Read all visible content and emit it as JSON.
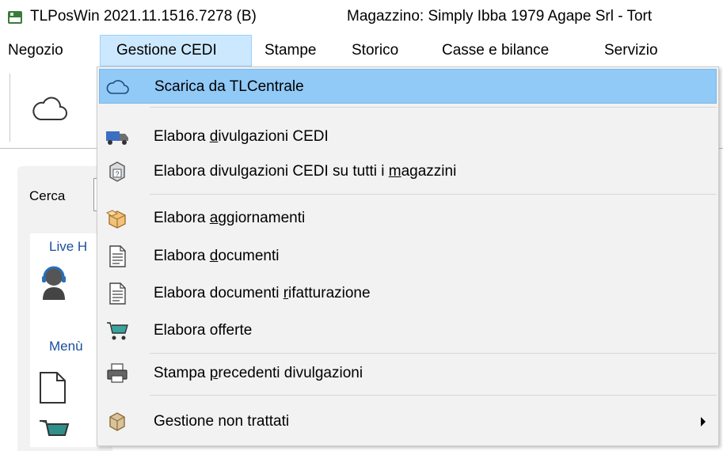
{
  "window": {
    "title": "TLPosWin 2021.11.1516.7278 (B)",
    "store": "Magazzino: Simply Ibba 1979 Agape Srl - Tort"
  },
  "menubar": {
    "items": [
      {
        "label": "Negozio"
      },
      {
        "label": "Gestione CEDI"
      },
      {
        "label": "Stampe"
      },
      {
        "label": "Storico"
      },
      {
        "label": "Casse e bilance"
      },
      {
        "label": "Servizio"
      }
    ]
  },
  "background": {
    "cerca_label": "Cerca",
    "live_label": "Live H",
    "menu_label": "Menù"
  },
  "dropdown": {
    "items": [
      {
        "pre": "Scarica da TLCentrale",
        "u": "",
        "post": "",
        "icon": "cloud-icon"
      },
      {
        "pre": "Elabora ",
        "u": "d",
        "post": "ivulgazioni CEDI",
        "icon": "truck-icon"
      },
      {
        "pre": "Elabora divulgazioni CEDI su tutti i ",
        "u": "m",
        "post": "agazzini",
        "icon": "box-question-icon"
      },
      {
        "pre": "Elabora ",
        "u": "a",
        "post": "ggiornamenti",
        "icon": "package-icon"
      },
      {
        "pre": "Elabora ",
        "u": "d",
        "post": "ocumenti",
        "icon": "document-icon"
      },
      {
        "pre": "Elabora documenti ",
        "u": "r",
        "post": "ifatturazione",
        "icon": "document-icon"
      },
      {
        "pre": "Elabora offerte",
        "u": "",
        "post": "",
        "icon": "shopping-cart-icon"
      },
      {
        "pre": "Stampa ",
        "u": "p",
        "post": "recedenti divulgazioni",
        "icon": "printer-icon"
      },
      {
        "pre": "Gestione non trattati",
        "u": "",
        "post": "",
        "icon": "box-icon"
      }
    ]
  }
}
